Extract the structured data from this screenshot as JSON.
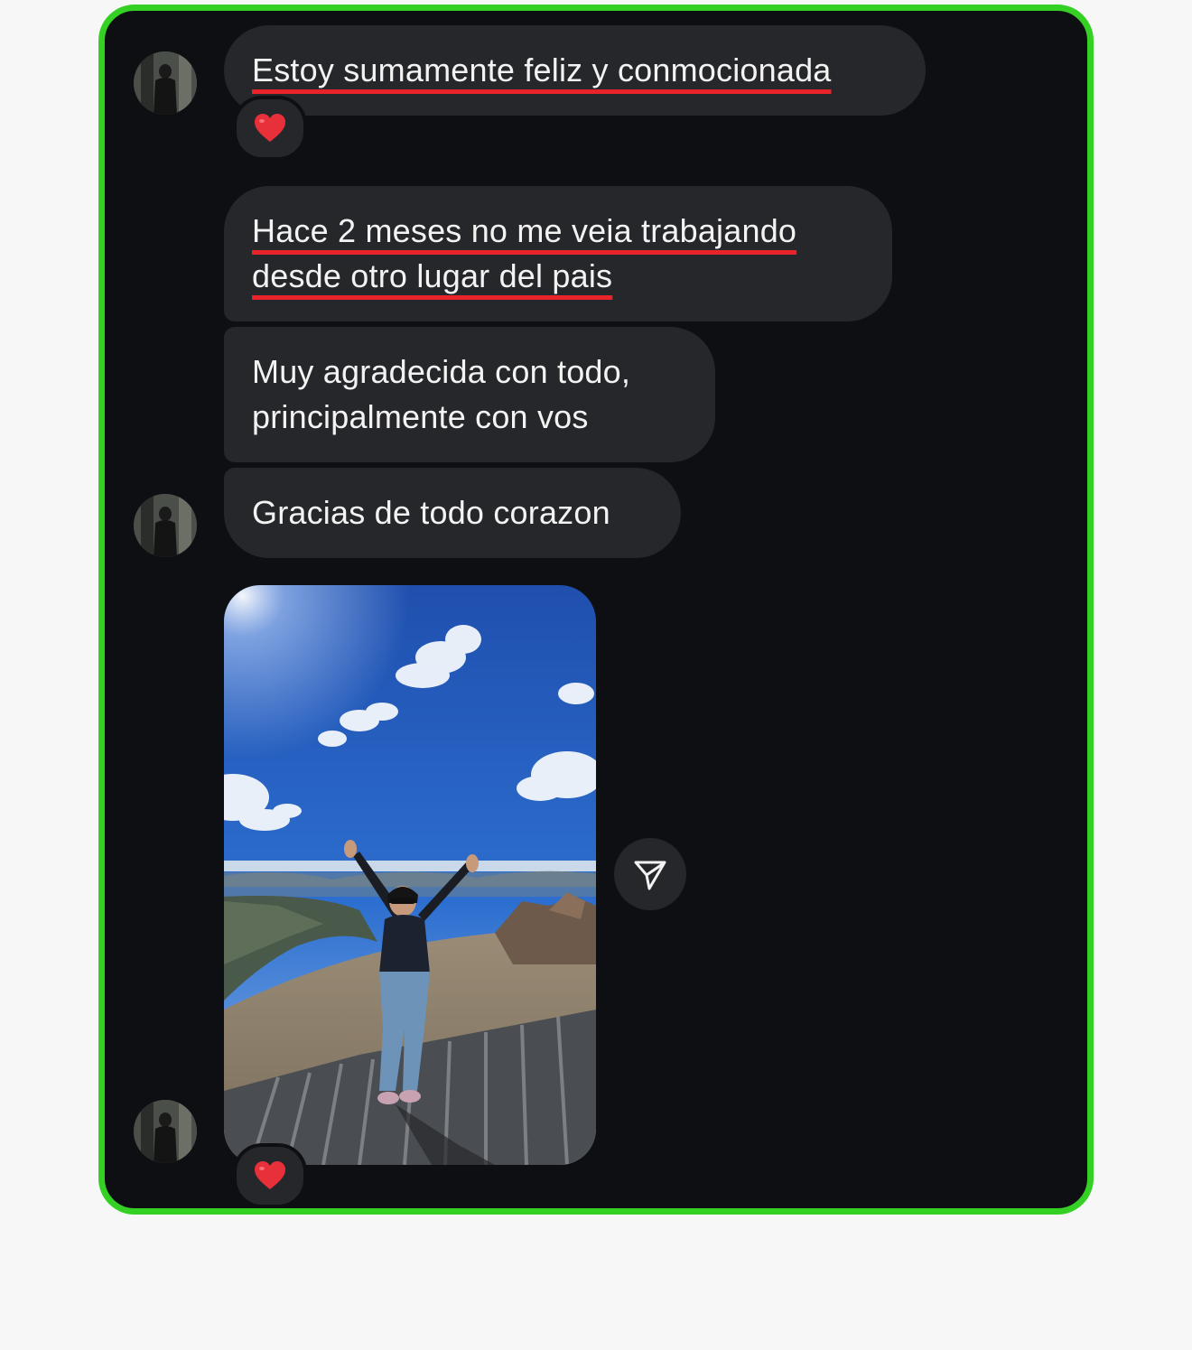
{
  "messages": [
    {
      "text": "Estoy sumamente feliz y conmocionada"
    },
    {
      "line1": "Hace 2 meses no me veia trabajando",
      "line2": "desde otro lugar del pais"
    },
    {
      "line1": "Muy agradecida con todo,",
      "line2": "principalmente con vos"
    },
    {
      "text": "Gracias de todo corazon"
    }
  ],
  "reactions": {
    "first_message": "heart-emoji",
    "photo": "heart-emoji"
  },
  "icons": {
    "share": "paper-plane-icon",
    "reaction": "red-heart-icon"
  },
  "colors": {
    "highlight_border": "#34d124",
    "underline": "#e8242a",
    "chat_background": "#0e0f13",
    "bubble": "#26272b"
  }
}
